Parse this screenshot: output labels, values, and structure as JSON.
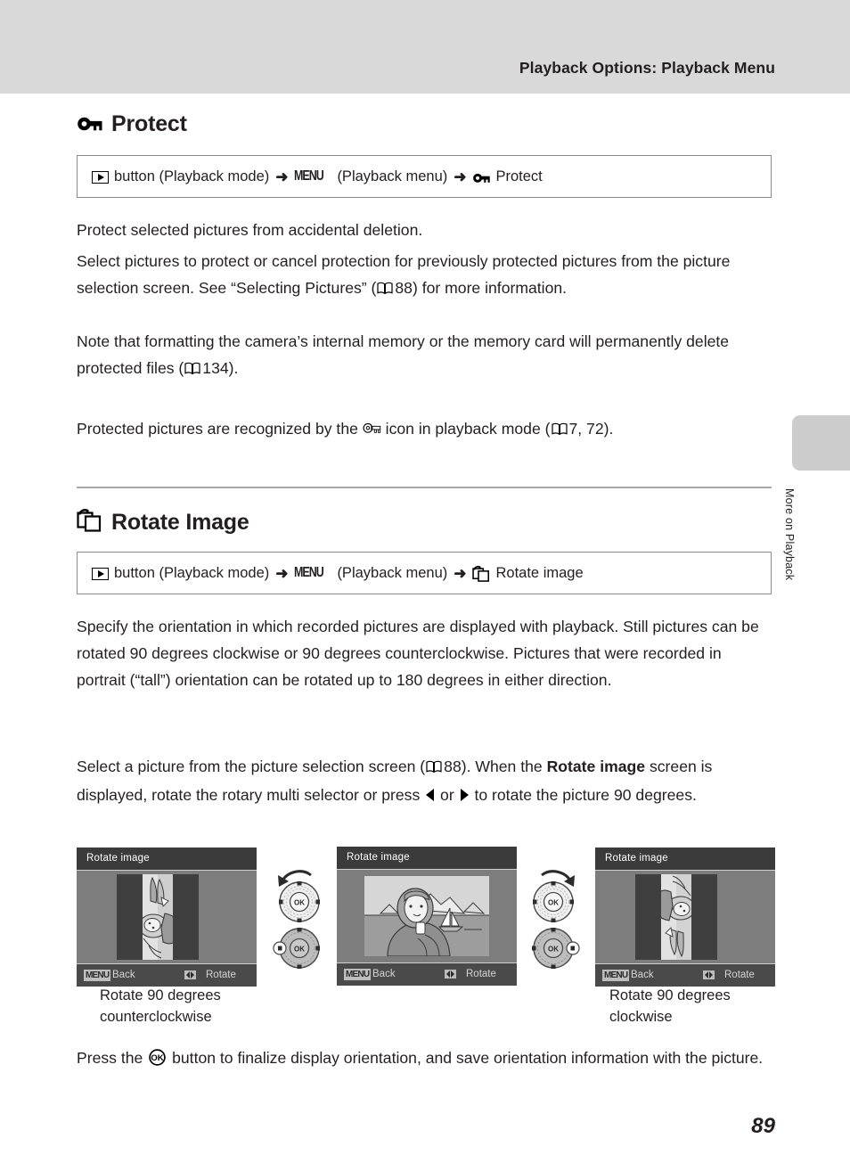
{
  "header": {
    "running_head": "Playback Options: Playback Menu"
  },
  "side_tab": {
    "label": "More on Playback"
  },
  "page_number": "89",
  "sections": [
    {
      "id": "protect",
      "icon": "key-icon",
      "title": "Protect",
      "path": {
        "play_icon": "play-button-icon",
        "seg1": "button (Playback mode)",
        "arrow": "➜",
        "menu_badge": "MENU",
        "seg2": "(Playback menu)",
        "arrow2": "➜",
        "target_icon": "key-icon",
        "seg3": "Protect"
      },
      "paragraphs": [
        "Protect selected pictures from accidental deletion.",
        "Select pictures to protect or cancel protection for previously protected pictures from the picture selection screen. See “Selecting Pictures” (A 88) for more information.",
        "Note that formatting the camera’s internal memory or the memory card will permanently delete protected files (A 134).",
        "Protected pictures are recognized by the [key] icon in playback mode (A 7, 72)."
      ],
      "refs": [
        "88",
        "134",
        "7, 72"
      ]
    },
    {
      "id": "rotate-image",
      "icon": "rotate-image-icon",
      "title": "Rotate Image",
      "path": {
        "play_icon": "play-button-icon",
        "seg1": "button (Playback mode)",
        "arrow": "➜",
        "menu_badge": "MENU",
        "seg2": "(Playback menu)",
        "arrow2": "➜",
        "target_icon": "rotate-image-icon",
        "seg3": "Rotate image"
      },
      "paragraphs": [
        "Specify the orientation in which recorded pictures are displayed with playback. Still pictures can be rotated 90 degrees clockwise or 90 degrees counterclockwise. Pictures that were recorded in portrait (“tall”) orientation can be rotated up to 180 degrees in either direction.",
        "Select a picture from the picture selection screen (A 88). When the Rotate image screen is displayed, rotate the rotary multi selector or press ◀ or ▶ to rotate the picture 90 degrees.",
        "Press the OK button to finalize display orientation, and save orientation information with the picture."
      ]
    }
  ],
  "body_text": {
    "protect_p1": "Protect selected pictures from accidental deletion.",
    "protect_p2_a": "Select pictures to protect or cancel protection for previously protected pictures from the picture selection screen. See “Selecting Pictures” (",
    "protect_p2_ref": "88",
    "protect_p2_b": ") for more information.",
    "protect_p3_a": "Note that formatting the camera’s internal memory or the memory card will permanently delete protected files (",
    "protect_p3_ref": "134",
    "protect_p3_b": ").",
    "protect_p4_a": "Protected pictures are recognized by the ",
    "protect_p4_b": " icon in playback mode (",
    "protect_p4_ref": "7, 72",
    "protect_p4_c": ").",
    "rotate_p1": "Specify the orientation in which recorded pictures are displayed with playback. Still pictures can be rotated 90 degrees clockwise or 90 degrees counterclockwise. Pictures that were recorded in portrait (“tall”) orientation can be rotated up to 180 degrees in either direction.",
    "rotate_p2_a": "Select a picture from the picture selection screen (",
    "rotate_p2_ref": "88",
    "rotate_p2_b": "). When the ",
    "rotate_p2_bold": "Rotate image",
    "rotate_p2_c": " screen is displayed, rotate the rotary multi selector or press ",
    "rotate_p2_or": " or ",
    "rotate_p2_d": " to rotate the picture 90 degrees.",
    "rotate_p3_a": "Press the ",
    "rotate_p3_b": " button to finalize display orientation, and save orientation information with the picture."
  },
  "screens": [
    {
      "id": "screen-ccw",
      "title": "Rotate image",
      "menu_chip": "MENU",
      "back_label": "Back",
      "rotate_label": "Rotate",
      "orientation": "portrait-ccw",
      "caption_line1": "Rotate 90 degrees",
      "caption_line2": "counterclockwise",
      "dial_direction": "counterclockwise",
      "dial_highlight": "left"
    },
    {
      "id": "screen-normal",
      "title": "Rotate image",
      "menu_chip": "MENU",
      "back_label": "Back",
      "rotate_label": "Rotate",
      "orientation": "landscape",
      "caption_line1": "",
      "caption_line2": "",
      "dial_direction": "clockwise",
      "dial_highlight": "right"
    },
    {
      "id": "screen-cw",
      "title": "Rotate image",
      "menu_chip": "MENU",
      "back_label": "Back",
      "rotate_label": "Rotate",
      "orientation": "portrait-cw",
      "caption_line1": "Rotate 90 degrees",
      "caption_line2": "clockwise"
    }
  ],
  "dial_labels": {
    "ok": "OK"
  },
  "colors": {
    "header_band": "#d9d9d9",
    "side_tab": "#cccccc",
    "text": "#231f20",
    "rule": "#a6a6a6",
    "screen_chrome": "#3b3b3b",
    "screen_bg": "#7d7d7d",
    "screen_bar": "#4a4a4a"
  }
}
